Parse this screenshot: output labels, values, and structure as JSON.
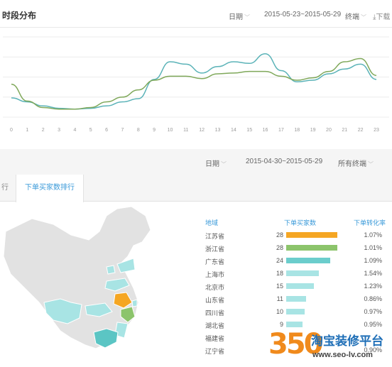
{
  "hourly": {
    "title": "时段分布",
    "date_label": "日期",
    "date_range": "2015-05-23~2015-05-29",
    "terminal": "终端",
    "download": "下载",
    "download_icon": "download-icon",
    "chart_data": {
      "type": "line",
      "x": [
        "0",
        "1",
        "2",
        "3",
        "4",
        "5",
        "6",
        "7",
        "8",
        "9",
        "10",
        "11",
        "12",
        "13",
        "14",
        "15",
        "16",
        "17",
        "18",
        "19",
        "20",
        "21",
        "22",
        "23"
      ],
      "ylim": [
        0,
        100
      ],
      "grid": true,
      "series": [
        {
          "color": "#5bb3b8",
          "values": [
            24,
            19,
            14,
            11,
            10,
            11,
            14,
            19,
            23,
            47,
            69,
            66,
            55,
            63,
            69,
            67,
            79,
            58,
            44,
            46,
            54,
            60,
            66,
            47
          ]
        },
        {
          "color": "#7fa85a",
          "values": [
            41,
            20,
            12,
            10,
            10,
            12,
            19,
            25,
            34,
            46,
            51,
            51,
            48,
            54,
            55,
            57,
            57,
            51,
            46,
            49,
            57,
            69,
            73,
            52
          ]
        }
      ]
    }
  },
  "filters": {
    "date_label": "日期",
    "date_range": "2015-04-30~2015-05-29",
    "terminal": "所有终端"
  },
  "tabs": [
    {
      "label": "行"
    },
    {
      "label": "下单买家数排行"
    }
  ],
  "ranking": {
    "headers": {
      "region": "地域",
      "buyers": "下单买家数",
      "rate": "下单转化率"
    },
    "rows": [
      {
        "province": "江苏省",
        "count": "28",
        "value": 28,
        "rate": "1.07%",
        "color": "#f5a623"
      },
      {
        "province": "浙江省",
        "count": "28",
        "value": 28,
        "rate": "1.01%",
        "color": "#8cc46b"
      },
      {
        "province": "广东省",
        "count": "24",
        "value": 24,
        "rate": "1.09%",
        "color": "#6bcdcc"
      },
      {
        "province": "上海市",
        "count": "18",
        "value": 18,
        "rate": "1.54%",
        "color": "#a8e4e4"
      },
      {
        "province": "北京市",
        "count": "15",
        "value": 15,
        "rate": "1.23%",
        "color": "#a8e4e4"
      },
      {
        "province": "山东省",
        "count": "11",
        "value": 11,
        "rate": "0.86%",
        "color": "#a8e4e4"
      },
      {
        "province": "四川省",
        "count": "10",
        "value": 10,
        "rate": "0.97%",
        "color": "#a8e4e4"
      },
      {
        "province": "湖北省",
        "count": "9",
        "value": 9,
        "rate": "0.95%",
        "color": "#a8e4e4"
      },
      {
        "province": "福建省",
        "count": "",
        "value": 0,
        "rate": "",
        "color": "#a8e4e4"
      },
      {
        "province": "辽宁省",
        "count": "",
        "value": 0,
        "rate": "0.90%",
        "color": "#a8e4e4"
      }
    ]
  },
  "map": {
    "base_color": "#e2e2e2",
    "highlights": [
      {
        "province": "江苏省",
        "color": "#f5a623"
      },
      {
        "province": "浙江省",
        "color": "#8cc46b"
      },
      {
        "province": "广东省",
        "color": "#5bc5c4"
      },
      {
        "province": "上海市",
        "color": "#a8e4e4"
      },
      {
        "province": "北京市",
        "color": "#a8e4e4"
      },
      {
        "province": "山东省",
        "color": "#a8e4e4"
      },
      {
        "province": "四川省",
        "color": "#a8e4e4"
      },
      {
        "province": "湖北省",
        "color": "#a8e4e4"
      },
      {
        "province": "福建省",
        "color": "#a8e4e4"
      },
      {
        "province": "辽宁省",
        "color": "#a8e4e4"
      }
    ]
  },
  "watermark": {
    "number": "350",
    "name": "淘宝装修平台",
    "url": "www.seo-lv.com"
  }
}
